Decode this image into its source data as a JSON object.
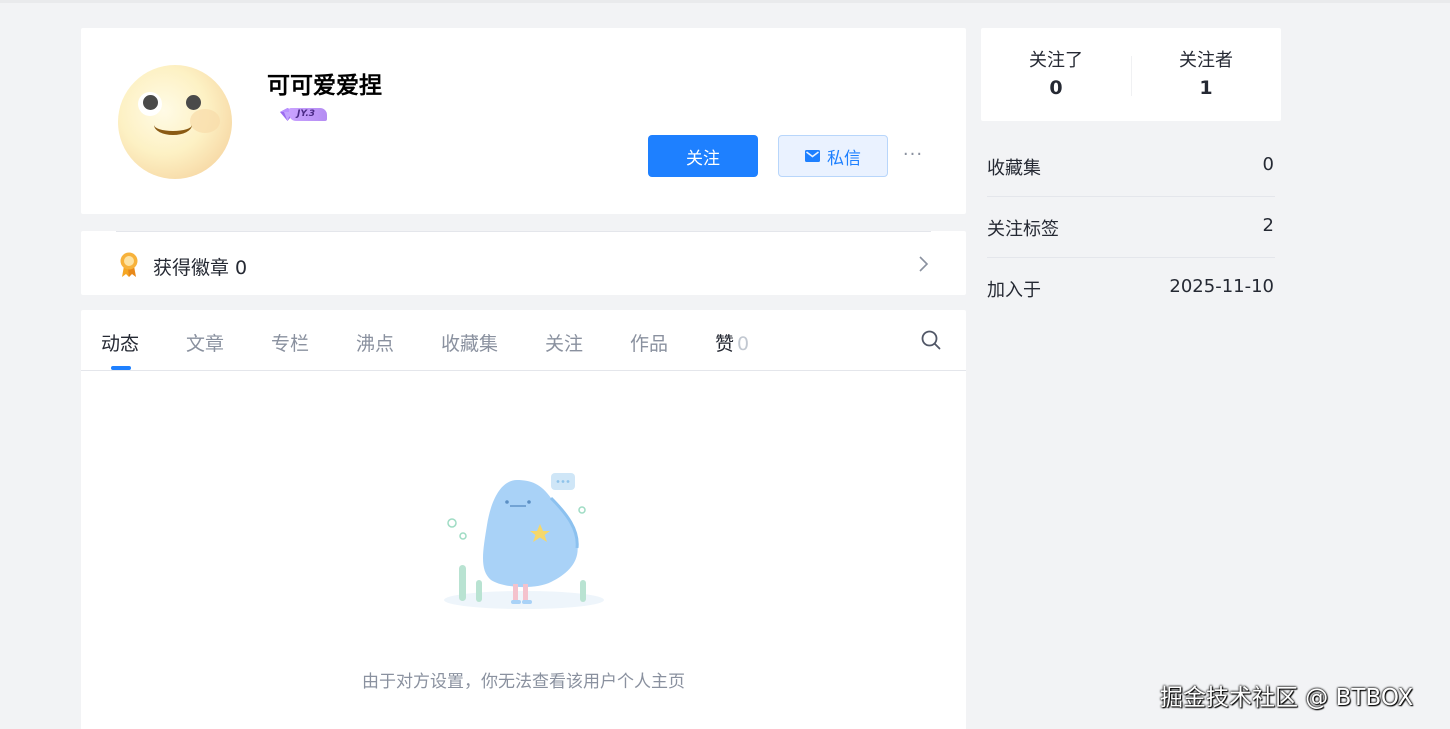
{
  "profile": {
    "username": "可可爱爱捏",
    "level": "JY.3",
    "follow_label": "关注",
    "message_label": "私信",
    "more_label": "···"
  },
  "badges": {
    "label": "获得徽章 0"
  },
  "tabs": [
    {
      "label": "动态"
    },
    {
      "label": "文章"
    },
    {
      "label": "专栏"
    },
    {
      "label": "沸点"
    },
    {
      "label": "收藏集"
    },
    {
      "label": "关注"
    },
    {
      "label": "作品"
    },
    {
      "label": "赞",
      "count": "0"
    }
  ],
  "empty": {
    "text": "由于对方设置，你无法查看该用户个人主页"
  },
  "stats": {
    "following_label": "关注了",
    "following_value": "0",
    "followers_label": "关注者",
    "followers_value": "1"
  },
  "info": [
    {
      "key": "收藏集",
      "value": "0"
    },
    {
      "key": "关注标签",
      "value": "2"
    },
    {
      "key": "加入于",
      "value": "2025-11-10"
    }
  ],
  "watermark": "掘金技术社区 @ BTBOX",
  "colors": {
    "accent": "#1e80ff",
    "page_bg": "#f2f3f5",
    "muted_text": "#8a919f"
  }
}
